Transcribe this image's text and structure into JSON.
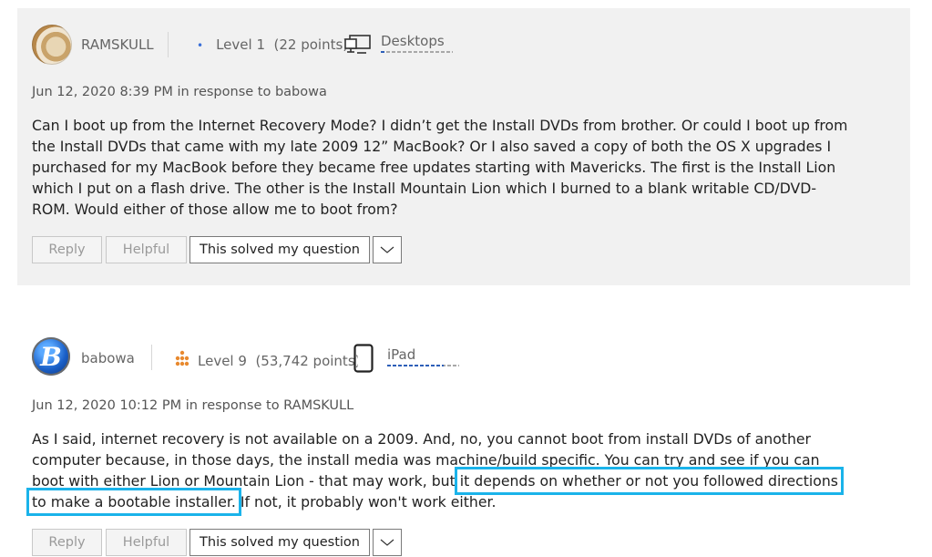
{
  "posts": [
    {
      "username": "RAMSKULL",
      "level": "Level 1",
      "points": "(22 points)",
      "device": "Desktops",
      "device_icon": "desktop-icon",
      "level_icon": "level-dot-icon",
      "level_progress": 0.08,
      "date": "Jun 12, 2020 8:39 PM",
      "in_response": "in response to babowa",
      "body": "Can I boot up from the Internet Recovery Mode? I didn’t get the Install DVDs from brother. Or could I boot up from the Install DVDs that came with my late 2009 12” MacBook? Or I also saved a copy of both the OS X upgrades I purchased for my MacBook before they became free updates starting with Mavericks. The first is the Install Lion which I put on a flash drive. The other is the Install Mountain Lion which I burned to a blank writable CD/DVD-ROM. Would either of those allow me to boot from?",
      "buttons": {
        "reply": "Reply",
        "helpful": "Helpful",
        "solved": "This solved my question"
      }
    },
    {
      "username": "babowa",
      "avatar_letter": "B",
      "level": "Level 9",
      "points": "(53,742 points)",
      "device": "iPad",
      "device_icon": "tablet-icon",
      "level_icon": "level-cluster-icon",
      "level_progress": 0.78,
      "date": "Jun 12, 2020 10:12 PM",
      "in_response": "in response to RAMSKULL",
      "body_before": "As I said, internet recovery is not available on a 2009. And, no, you cannot boot from install DVDs of another computer because, in those days, the install media was machine/build specific. You can try and see if you can boot with either Lion or Mountain Lion - that may work, but ",
      "body_highlight": "it depends on whether or not you followed directions to make a bootable installer.",
      "body_after": " If not, it probably won't work either.",
      "buttons": {
        "reply": "Reply",
        "helpful": "Helpful",
        "solved": "This solved my question"
      }
    }
  ],
  "colors": {
    "highlight": "#1ab3ea",
    "post_bg": "#f1f1f1",
    "level_accent": "#3a6fd8",
    "level9_accent": "#e8892f"
  }
}
